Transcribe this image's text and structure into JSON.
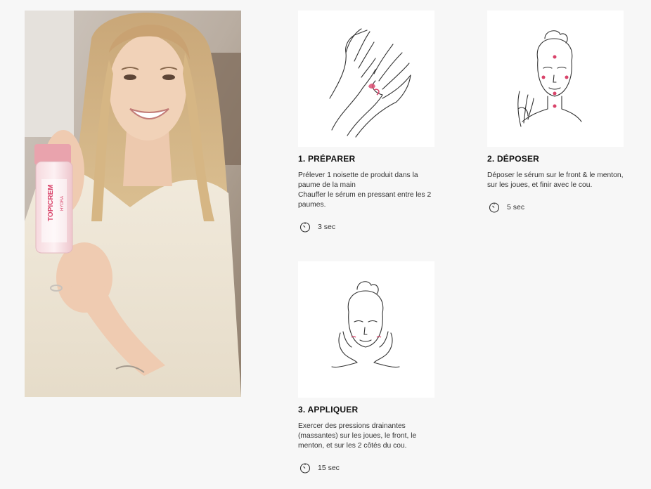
{
  "steps": [
    {
      "title": "1. PRÉPARER",
      "description": "Prélever 1 noisette de produit dans la paume de la main\nChauffer le sérum en pressant entre les 2 paumes.",
      "duration": "3 sec",
      "icon": "hands-illustration"
    },
    {
      "title": "2. DÉPOSER",
      "description": "Déposer le sérum sur le front & le menton, sur les joues, et finir avec le cou.",
      "duration": "5 sec",
      "icon": "face-dots-illustration"
    },
    {
      "title": "3. APPLIQUER",
      "description": "Exercer des pressions drainantes (massantes) sur les joues, le front, le menton, et sur les 2 côtés du cou.",
      "duration": "15 sec",
      "icon": "face-massage-illustration"
    }
  ],
  "hero": {
    "product_brand": "TOPICREM",
    "product_line": "HYDRA"
  },
  "colors": {
    "accent_pink": "#d9436a",
    "background": "#f7f7f7"
  }
}
